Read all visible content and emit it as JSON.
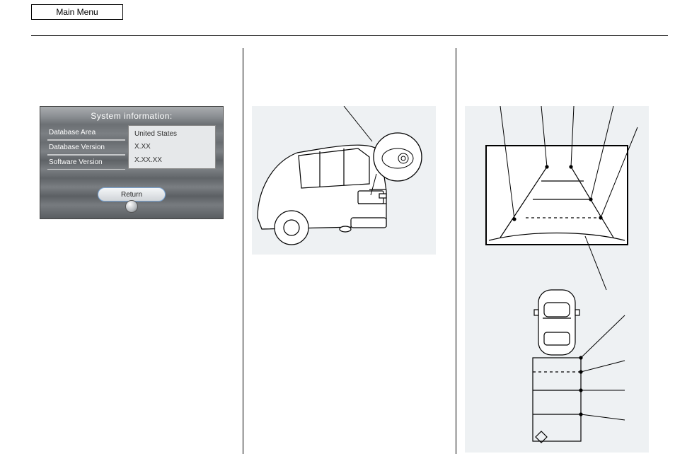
{
  "header": {
    "tabLabel": "Main Menu"
  },
  "col1": {
    "screenTitle": "System information:",
    "rows": [
      {
        "label": "Database Area",
        "value": "United States"
      },
      {
        "label": "Database Version",
        "value": "X.XX"
      },
      {
        "label": "Software Version",
        "value": "X.XX.XX"
      }
    ],
    "returnLabel": "Return"
  }
}
